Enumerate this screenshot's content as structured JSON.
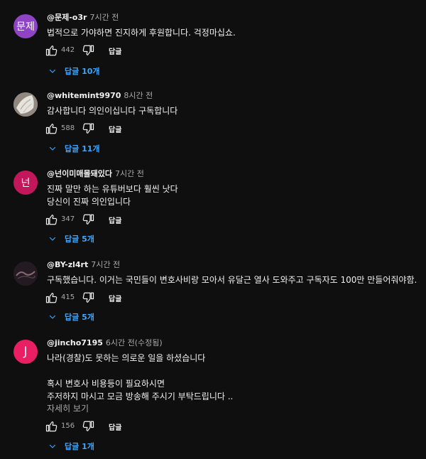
{
  "colors": {
    "background": "#0f0f0f",
    "text_primary": "#f1f1f1",
    "text_secondary": "#aaaaaa",
    "link_blue": "#3ea6ff"
  },
  "icons": {
    "like": "thumb-up-outline",
    "dislike": "thumb-down-outline",
    "expand": "chevron-down"
  },
  "comments": [
    {
      "avatar_text": "문제",
      "avatar_color": "#8e44c5",
      "author": "@문제-o3r",
      "time": "7시간 전",
      "lines": [
        "법적으로 가야하면 진지하게 후원합니다. 걱정마십쇼."
      ],
      "likes": "442",
      "reply_label": "답글",
      "replies_label": "답글 10개"
    },
    {
      "avatar_text": "",
      "avatar_color": "#b9b2a8",
      "author": "@whitemint9970",
      "time": "8시간 전",
      "lines": [
        "감사합니다 의인이십니다 구독합니다"
      ],
      "likes": "588",
      "reply_label": "답글",
      "replies_label": "답글 11개"
    },
    {
      "avatar_text": "넌",
      "avatar_color": "#c2185b",
      "author": "@넌이미매몰돼있다",
      "time": "7시간 전",
      "lines": [
        "진짜 말만 하는 유튜버보다 훨씬 낫다",
        "당신이 진짜 의인입니다"
      ],
      "likes": "347",
      "reply_label": "답글",
      "replies_label": "답글 5개"
    },
    {
      "avatar_text": "",
      "avatar_color": "#2a2028",
      "author": "@BY-zl4rt",
      "time": "7시간 전",
      "lines": [
        "구독했습니다. 이거는 국민들이 변호사비랑 모아서 유달근 열사 도와주고 구독자도 100만 만들어줘야함."
      ],
      "likes": "415",
      "reply_label": "답글",
      "replies_label": "답글 5개"
    },
    {
      "avatar_text": "J",
      "avatar_color": "#e91e63",
      "author": "@jincho7195",
      "time": "6시간 전(수정됨)",
      "lines": [
        "나라(경찰)도 못하는 의로운 일을 하셨습니다",
        "",
        "혹시 변호사 비용등이 필요하시면",
        "주저하지 마시고 모금 방송해 주시기 부탁드립니다 .."
      ],
      "more_label": "자세히 보기",
      "likes": "156",
      "reply_label": "답글",
      "replies_label": "답글 1개"
    }
  ]
}
